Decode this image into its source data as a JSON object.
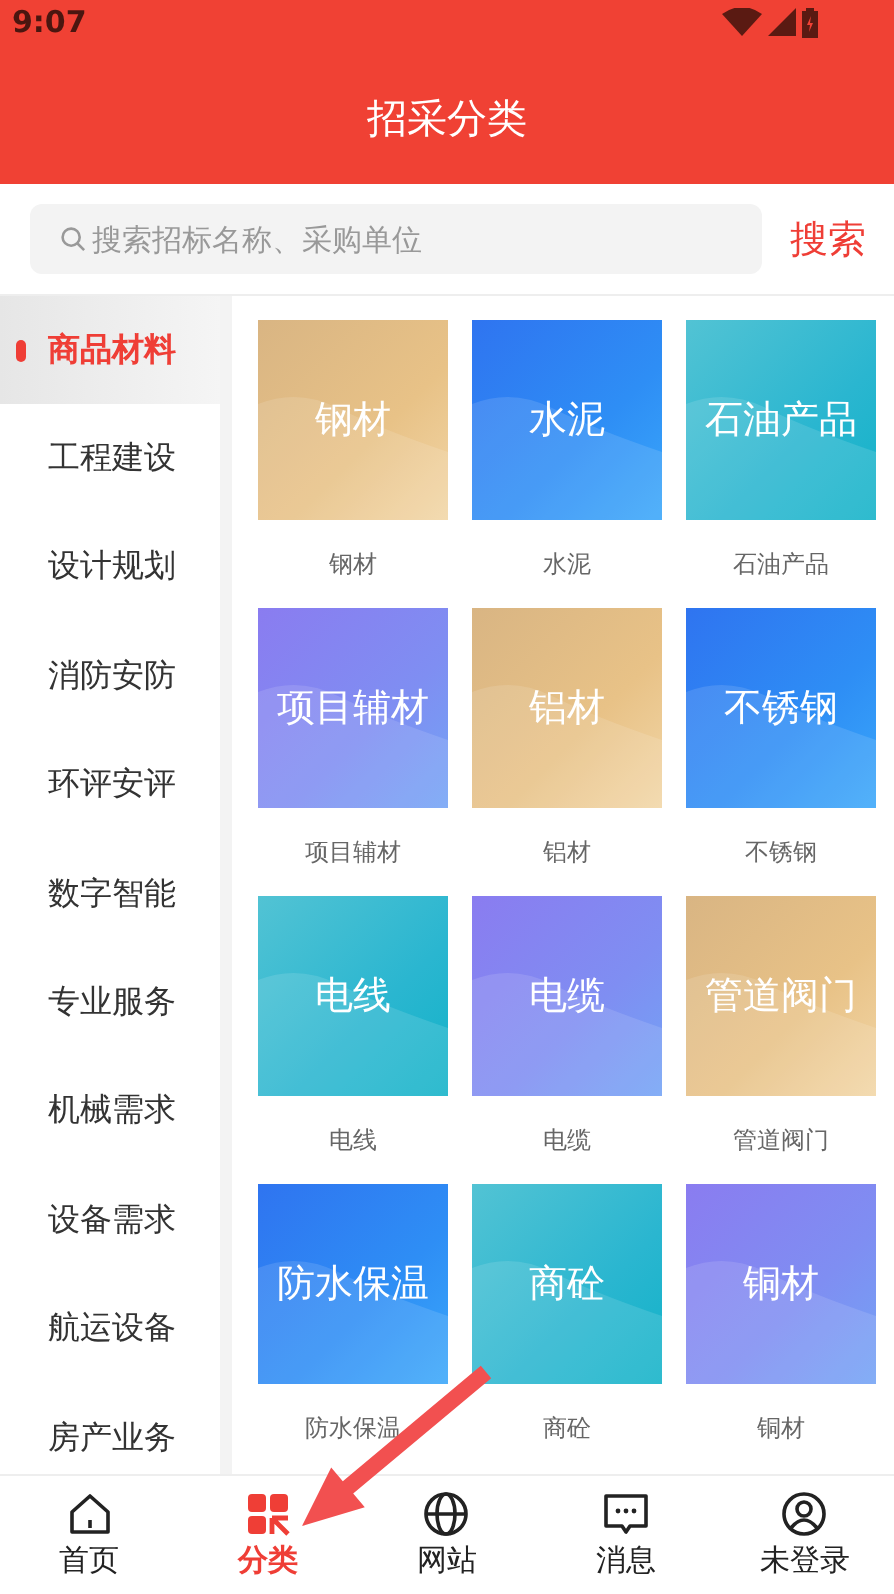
{
  "status_bar": {
    "time": "9:07"
  },
  "header": {
    "title": "招采分类"
  },
  "search": {
    "placeholder": "搜索招标名称、采购单位",
    "button": "搜索"
  },
  "sidebar": {
    "items": [
      {
        "label": "商品材料",
        "selected": true
      },
      {
        "label": "工程建设",
        "selected": false
      },
      {
        "label": "设计规划",
        "selected": false
      },
      {
        "label": "消防安防",
        "selected": false
      },
      {
        "label": "环评安评",
        "selected": false
      },
      {
        "label": "数字智能",
        "selected": false
      },
      {
        "label": "专业服务",
        "selected": false
      },
      {
        "label": "机械需求",
        "selected": false
      },
      {
        "label": "设备需求",
        "selected": false
      },
      {
        "label": "航运设备",
        "selected": false
      },
      {
        "label": "房产业务",
        "selected": false
      }
    ]
  },
  "categories": [
    {
      "tile_text": "钢材",
      "label": "钢材",
      "kind": "gold"
    },
    {
      "tile_text": "水泥",
      "label": "水泥",
      "kind": "blue"
    },
    {
      "tile_text": "石油产品",
      "label": "石油产品",
      "kind": "teal"
    },
    {
      "tile_text": "项目辅材",
      "label": "项目辅材",
      "kind": "purple"
    },
    {
      "tile_text": "铝材",
      "label": "铝材",
      "kind": "gold"
    },
    {
      "tile_text": "不锈钢",
      "label": "不锈钢",
      "kind": "blue"
    },
    {
      "tile_text": "电线",
      "label": "电线",
      "kind": "teal"
    },
    {
      "tile_text": "电缆",
      "label": "电缆",
      "kind": "purple"
    },
    {
      "tile_text": "管道阀门",
      "label": "管道阀门",
      "kind": "gold"
    },
    {
      "tile_text": "防水保温",
      "label": "防水保温",
      "kind": "blue"
    },
    {
      "tile_text": "商砼",
      "label": "商砼",
      "kind": "teal"
    },
    {
      "tile_text": "铜材",
      "label": "铜材",
      "kind": "purple"
    }
  ],
  "tab_bar": [
    {
      "label": "首页",
      "kind": "home",
      "selected": false
    },
    {
      "label": "分类",
      "kind": "category",
      "selected": true
    },
    {
      "label": "网站",
      "kind": "globe",
      "selected": false
    },
    {
      "label": "消息",
      "kind": "message",
      "selected": false
    },
    {
      "label": "未登录",
      "kind": "user",
      "selected": false
    }
  ]
}
